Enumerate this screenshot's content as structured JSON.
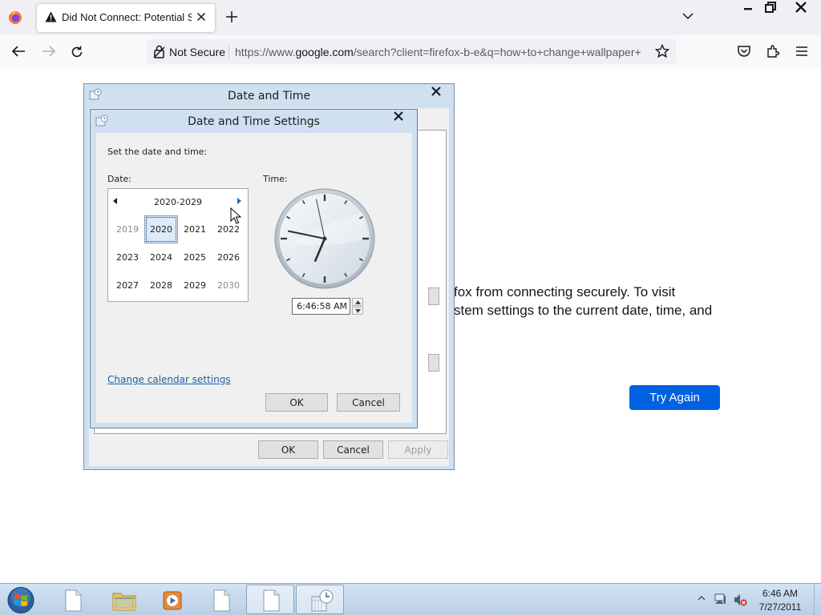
{
  "browser": {
    "tab_title": "Did Not Connect: Potential Security Issue",
    "url_security_label": "Not Secure",
    "url_prefix": "https://www.",
    "url_host": "google.com",
    "url_path": "/search?client=firefox-b-e&q=how+to+change+wallpaper+",
    "icons": [
      "firefox-logo-icon",
      "warning-icon",
      "close-icon",
      "plus-icon",
      "chevron-down-icon",
      "minimize-icon",
      "restore-icon",
      "back-arrow-icon",
      "forward-arrow-icon",
      "reload-icon",
      "lock-slash-icon",
      "star-icon",
      "pocket-icon",
      "extensions-icon",
      "hamburger-menu-icon"
    ]
  },
  "page": {
    "error_line1": "fox from connecting securely. To visit",
    "error_line2": "stem settings to the current date, time, and",
    "try_again_label": "Try Again",
    "accent_color": "#0061e0"
  },
  "date_time_dialog": {
    "title": "Date and Time",
    "ok_label": "OK",
    "cancel_label": "Cancel",
    "apply_label": "Apply"
  },
  "settings_dialog": {
    "title": "Date and Time Settings",
    "instruction": "Set the date and time:",
    "date_label": "Date:",
    "time_label": "Time:",
    "calendar": {
      "header": "2020-2029",
      "years": [
        {
          "label": "2019",
          "in_range": false,
          "selected": false
        },
        {
          "label": "2020",
          "in_range": true,
          "selected": true
        },
        {
          "label": "2021",
          "in_range": true,
          "selected": false
        },
        {
          "label": "2022",
          "in_range": true,
          "selected": false
        },
        {
          "label": "2023",
          "in_range": true,
          "selected": false
        },
        {
          "label": "2024",
          "in_range": true,
          "selected": false
        },
        {
          "label": "2025",
          "in_range": true,
          "selected": false
        },
        {
          "label": "2026",
          "in_range": true,
          "selected": false
        },
        {
          "label": "2027",
          "in_range": true,
          "selected": false
        },
        {
          "label": "2028",
          "in_range": true,
          "selected": false
        },
        {
          "label": "2029",
          "in_range": true,
          "selected": false
        },
        {
          "label": "2030",
          "in_range": false,
          "selected": false
        }
      ]
    },
    "clock": {
      "hours": 6,
      "minutes": 46,
      "seconds": 58
    },
    "time_value": "6:46:58 AM",
    "change_calendar_link": "Change calendar settings",
    "ok_label": "OK",
    "cancel_label": "Cancel"
  },
  "taskbar": {
    "items": [
      "document",
      "file-explorer",
      "media-player",
      "document",
      "document",
      "date-time-settings"
    ],
    "active_items": [
      4,
      5
    ],
    "clock_time": "6:46 AM",
    "clock_date": "7/27/2011"
  }
}
